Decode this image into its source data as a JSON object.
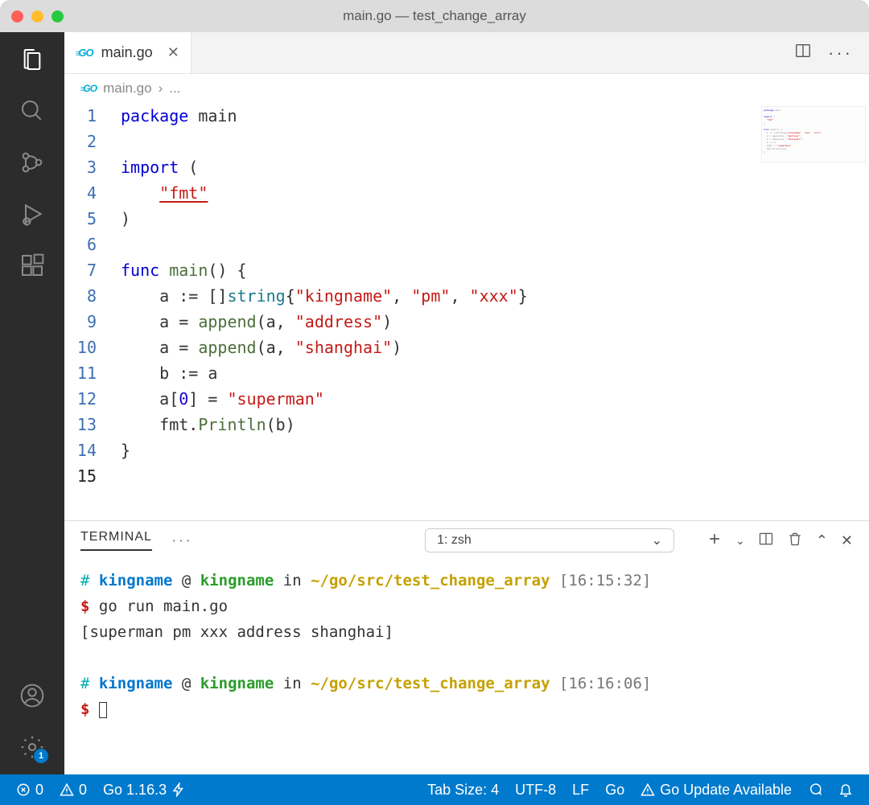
{
  "window": {
    "title": "main.go — test_change_array"
  },
  "activitybar": {
    "settings_badge": "1"
  },
  "tab": {
    "filename": "main.go"
  },
  "breadcrumb": {
    "filename": "main.go",
    "separator": "›",
    "more": "..."
  },
  "editor": {
    "lines": [
      {
        "n": "1",
        "html": "<span class='tok-kw'>package</span> <span class='tok-pkg'>main</span>"
      },
      {
        "n": "2",
        "html": ""
      },
      {
        "n": "3",
        "html": "<span class='tok-kw'>import</span> ("
      },
      {
        "n": "4",
        "html": "    <span class='tok-str tok-under'>\"fmt\"</span>"
      },
      {
        "n": "5",
        "html": ")"
      },
      {
        "n": "6",
        "html": ""
      },
      {
        "n": "7",
        "html": "<span class='tok-kw'>func</span> <span class='tok-fn'>main</span>() {"
      },
      {
        "n": "8",
        "html": "    a := []<span class='tok-type'>string</span>{<span class='tok-str'>\"kingname\"</span>, <span class='tok-str'>\"pm\"</span>, <span class='tok-str'>\"xxx\"</span>}"
      },
      {
        "n": "9",
        "html": "    a = <span class='tok-fn'>append</span>(a, <span class='tok-str'>\"address\"</span>)"
      },
      {
        "n": "10",
        "html": "    a = <span class='tok-fn'>append</span>(a, <span class='tok-str'>\"shanghai\"</span>)"
      },
      {
        "n": "11",
        "html": "    b := a"
      },
      {
        "n": "12",
        "html": "    a[<span class='tok-num'>0</span>] = <span class='tok-str'>\"superman\"</span>"
      },
      {
        "n": "13",
        "html": "    fmt.<span class='tok-fn'>Println</span>(b)"
      },
      {
        "n": "14",
        "html": "}"
      },
      {
        "n": "15",
        "html": ""
      }
    ],
    "current_line": "15"
  },
  "panel": {
    "tab_label": "TERMINAL",
    "shell_selector": "1: zsh"
  },
  "terminal": {
    "lines": [
      {
        "type": "prompt_header",
        "user": "kingname",
        "host": "kingname",
        "path": "~/go/src/test_change_array",
        "time": "[16:15:32]"
      },
      {
        "type": "cmd",
        "text": "go run main.go"
      },
      {
        "type": "out",
        "text": "[superman pm xxx address shanghai]"
      },
      {
        "type": "blank"
      },
      {
        "type": "prompt_header",
        "user": "kingname",
        "host": "kingname",
        "path": "~/go/src/test_change_array",
        "time": "[16:16:06]"
      },
      {
        "type": "cmd_cursor"
      }
    ]
  },
  "statusbar": {
    "errors": "0",
    "warnings": "0",
    "go_version": "Go 1.16.3",
    "tab_size": "Tab Size: 4",
    "encoding": "UTF-8",
    "eol": "LF",
    "language": "Go",
    "update_msg": "Go Update Available"
  }
}
